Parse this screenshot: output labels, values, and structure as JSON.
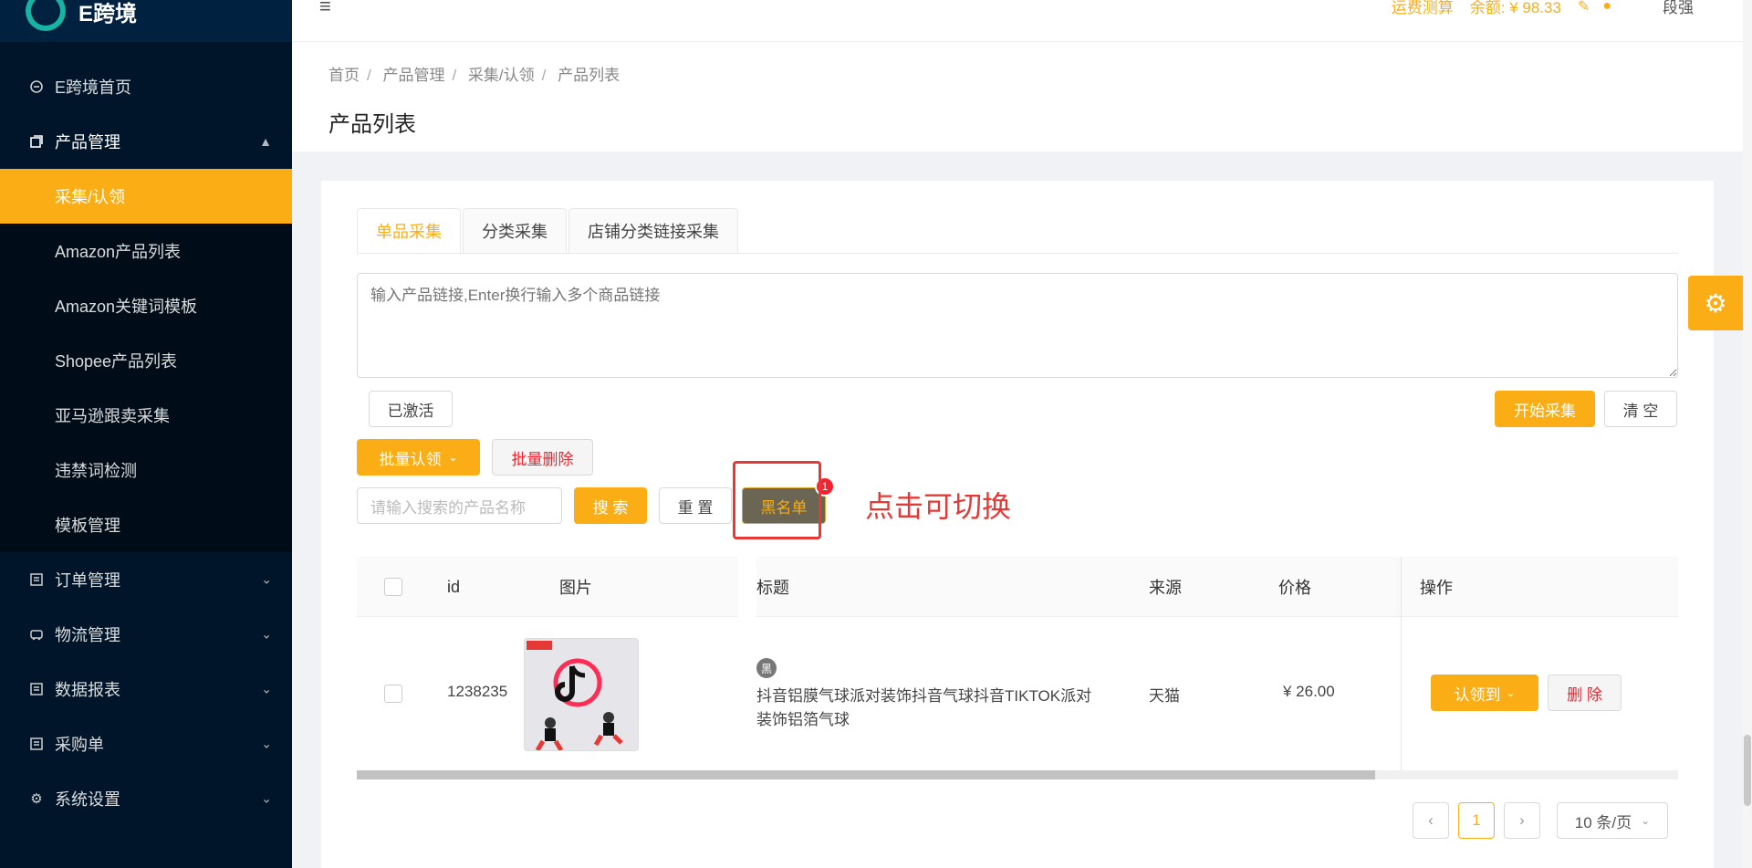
{
  "app": {
    "title": "E跨境"
  },
  "header": {
    "shipping_calc": "运费测算",
    "balance": "余额: ¥ 98.33",
    "user": "段强"
  },
  "sidebar": {
    "items": [
      {
        "label": "E跨境首页",
        "icon": "home-icon"
      },
      {
        "label": "产品管理",
        "icon": "product-icon",
        "expanded": true,
        "children": [
          {
            "label": "采集/认领",
            "active": true
          },
          {
            "label": "Amazon产品列表"
          },
          {
            "label": "Amazon关键词模板"
          },
          {
            "label": "Shopee产品列表"
          },
          {
            "label": "亚马逊跟卖采集"
          },
          {
            "label": "违禁词检测"
          },
          {
            "label": "模板管理"
          }
        ]
      },
      {
        "label": "订单管理",
        "icon": "order-icon"
      },
      {
        "label": "物流管理",
        "icon": "truck-icon"
      },
      {
        "label": "数据报表",
        "icon": "report-icon"
      },
      {
        "label": "采购单",
        "icon": "purchase-icon"
      },
      {
        "label": "系统设置",
        "icon": "gear-icon"
      }
    ]
  },
  "breadcrumb": [
    "首页",
    "产品管理",
    "采集/认领",
    "产品列表"
  ],
  "page_title": "产品列表",
  "tabs": [
    {
      "label": "单品采集",
      "active": true
    },
    {
      "label": "分类采集"
    },
    {
      "label": "店铺分类链接采集"
    }
  ],
  "collect": {
    "placeholder": "输入产品链接,Enter换行输入多个商品链接",
    "activated_label": "已激活",
    "start_label": "开始采集",
    "clear_label": "清 空"
  },
  "actions": {
    "batch_claim": "批量认领",
    "batch_delete": "批量删除",
    "search_placeholder": "请输入搜索的产品名称",
    "search": "搜 索",
    "reset": "重 置",
    "blacklist": "黑名单",
    "blacklist_badge": "1"
  },
  "annotation": "点击可切换",
  "table": {
    "columns": [
      "id",
      "图片",
      "标题",
      "来源",
      "价格",
      "操作"
    ],
    "rows": [
      {
        "id": "1238235",
        "tag": "黑",
        "title_line1": "抖音铝膜气球派对装饰抖音气球抖音TIKTOK派对",
        "title_line2": "装饰铝箔气球",
        "source": "天猫",
        "price": "¥ 26.00",
        "claim_label": "认领到",
        "delete_label": "删 除"
      }
    ]
  },
  "pagination": {
    "current": "1",
    "page_size": "10 条/页"
  },
  "colors": {
    "accent": "#faad14",
    "sidebar": "#001529",
    "danger": "#f5222d"
  }
}
